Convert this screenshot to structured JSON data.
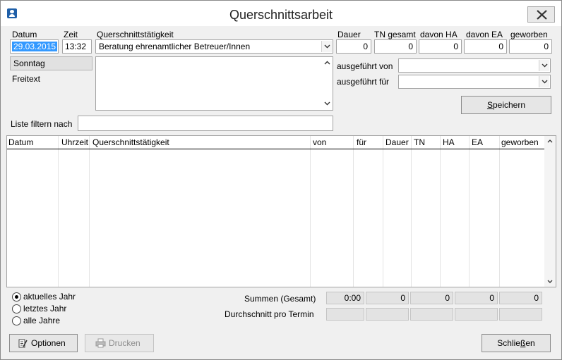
{
  "window": {
    "title": "Querschnittsarbeit"
  },
  "form": {
    "datum_label": "Datum",
    "datum_value": "29.03.2015",
    "zeit_label": "Zeit",
    "zeit_value": "13:32",
    "weekday": "Sonntag",
    "freitext_label": "Freitext",
    "taetigkeit_label": "Querschnittstätigkeit",
    "taetigkeit_value": "Beratung ehrenamtlicher Betreuer/Innen",
    "dauer_label": "Dauer",
    "dauer_value": "0",
    "tn_label": "TN gesamt",
    "tn_value": "0",
    "ha_label": "davon HA",
    "ha_value": "0",
    "ea_label": "davon EA",
    "ea_value": "0",
    "geworben_label": "geworben",
    "geworben_value": "0",
    "ausgefuehrt_von_label": "ausgeführt von",
    "ausgefuehrt_von_value": "",
    "ausgefuehrt_fuer_label": "ausgeführt für",
    "ausgefuehrt_fuer_value": "",
    "save_label_underlined": "S",
    "save_label_rest": "peichern",
    "filter_label": "Liste filtern nach",
    "filter_value": ""
  },
  "table": {
    "columns": [
      "Datum",
      "Uhrzeit",
      "Querschnittstätigkeit",
      "von",
      "für",
      "Dauer",
      "TN",
      "HA",
      "EA",
      "geworben"
    ],
    "rows": []
  },
  "years": {
    "options": [
      "aktuelles Jahr",
      "letztes Jahr",
      "alle Jahre"
    ],
    "selected": 0
  },
  "summary": {
    "sum_label": "Summen (Gesamt)",
    "avg_label": "Durchschnitt pro Termin",
    "sum_values": [
      "0:00",
      "0",
      "0",
      "0",
      "0"
    ],
    "avg_values": [
      "",
      "",
      "",
      "",
      ""
    ]
  },
  "footer": {
    "options_label": "Optionen",
    "print_label": "Drucken",
    "close_label_pre": "Schlie",
    "close_label_underlined": "ß",
    "close_label_post": "en"
  },
  "icons": {
    "app": "user-badge-icon",
    "close": "close-x-icon",
    "options": "options-edit-icon",
    "print": "printer-icon"
  }
}
